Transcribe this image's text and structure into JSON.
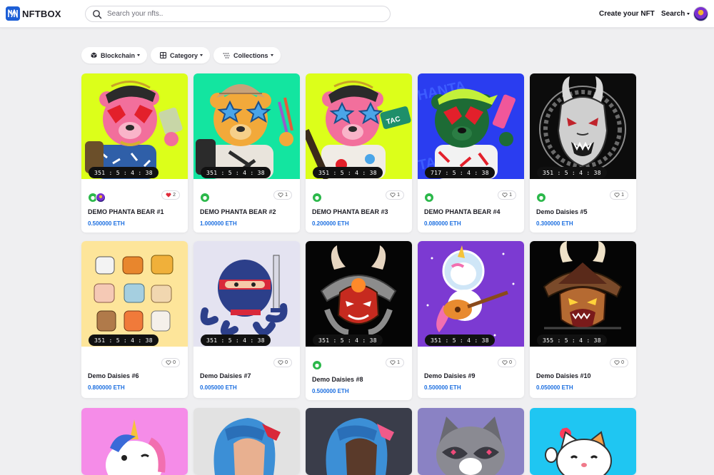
{
  "header": {
    "brand": "NFTBOX",
    "search_placeholder": "Search your nfts..",
    "create_label": "Create your NFT",
    "search_label": "Search"
  },
  "filters": [
    {
      "label": "Blockchain",
      "icon": "cube-icon"
    },
    {
      "label": "Category",
      "icon": "grid-icon"
    },
    {
      "label": "Collections",
      "icon": "collections-icon"
    }
  ],
  "cards": [
    {
      "title": "DEMO PHANTA BEAR #1",
      "price": "0.500000 ETH",
      "timer": "351 : 5 : 4 : 38",
      "likes": "2",
      "liked": true,
      "owners": 2,
      "art": "pink bear with money"
    },
    {
      "title": "DEMO PHANTA BEAR #2",
      "price": "1.000000 ETH",
      "timer": "351 : 5 : 4 : 38",
      "likes": "1",
      "liked": false,
      "owners": 1,
      "art": "orange bear painter"
    },
    {
      "title": "DEMO PHANTA BEAR #3",
      "price": "0.200000 ETH",
      "timer": "351 : 5 : 4 : 38",
      "likes": "1",
      "liked": false,
      "owners": 1,
      "art": "pink bear guitar"
    },
    {
      "title": "DEMO PHANTA BEAR #4",
      "price": "0.080000 ETH",
      "timer": "717 : 5 : 4 : 38",
      "likes": "1",
      "liked": false,
      "owners": 1,
      "art": "green bear blue background"
    },
    {
      "title": "Demo Daisies #5",
      "price": "0.300000 ETH",
      "timer": "351 : 5 : 4 : 38",
      "likes": "1",
      "liked": false,
      "owners": 1,
      "art": "samurai mask emblem"
    },
    {
      "title": "Demo Daisies #6",
      "price": "0.800000 ETH",
      "timer": "351 : 5 : 4 : 38",
      "likes": "0",
      "liked": false,
      "owners": 0,
      "art": "dog breeds"
    },
    {
      "title": "Demo Daisies #7",
      "price": "0.005000 ETH",
      "timer": "351 : 5 : 4 : 38",
      "likes": "0",
      "liked": false,
      "owners": 0,
      "art": "ninja octopus"
    },
    {
      "title": "Demo Daisies #8",
      "price": "0.500000 ETH",
      "timer": "351 : 5 : 4 : 38",
      "likes": "1",
      "liked": false,
      "owners": 1,
      "art": "red samurai helmet"
    },
    {
      "title": "Demo Daisies #9",
      "price": "0.500000 ETH",
      "timer": "351 : 5 : 4 : 38",
      "likes": "0",
      "liked": false,
      "owners": 0,
      "art": "unicorn astronaut guitar"
    },
    {
      "title": "Demo Daisies #10",
      "price": "0.050000 ETH",
      "timer": "355 : 5 : 4 : 38",
      "likes": "0",
      "liked": false,
      "owners": 0,
      "art": "oni samurai mask"
    }
  ],
  "partial_cards": [
    {
      "art": "unicorn"
    },
    {
      "art": "blue hair girl"
    },
    {
      "art": "blue hair girl dark"
    },
    {
      "art": "raccoon"
    },
    {
      "art": "cat with heart"
    }
  ],
  "colors": {
    "brand_blue": "#1d5fd6",
    "price_blue": "#1b6ee0",
    "like_red": "#e02a3a",
    "page_bg": "#efeff1"
  }
}
